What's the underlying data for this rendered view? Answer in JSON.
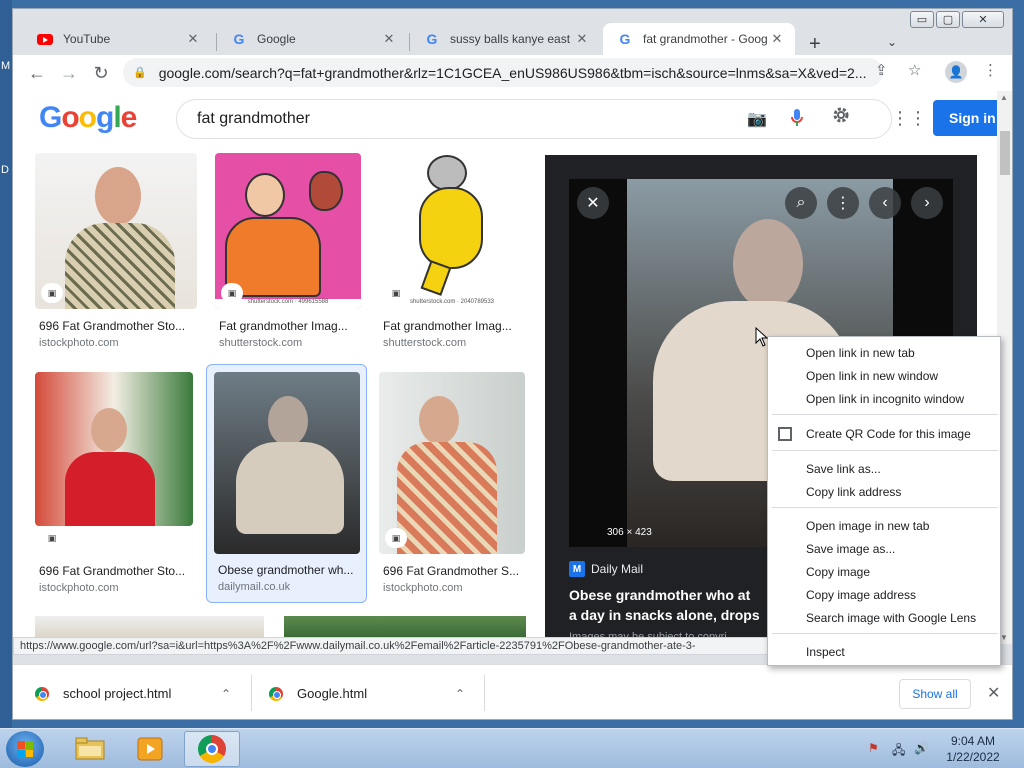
{
  "desktop": {
    "glyphs": [
      "M",
      "D"
    ]
  },
  "window_controls": {
    "minimize": "▭",
    "maximize": "▢",
    "close": "✕"
  },
  "tabs": [
    {
      "title": "YouTube",
      "icon": "youtube-icon"
    },
    {
      "title": "Google",
      "icon": "google-icon"
    },
    {
      "title": "sussy balls kanye east - G",
      "icon": "google-icon"
    },
    {
      "title": "fat grandmother - Goog",
      "icon": "google-icon",
      "active": true
    }
  ],
  "tab_close": "✕",
  "new_tab": "+",
  "tab_search": "⌄",
  "toolbar": {
    "back": "←",
    "forward": "→",
    "reload": "↻",
    "url": "google.com/search?q=fat+grandmother&rlz=1C1GCEA_enUS986US986&tbm=isch&source=lnms&sa=X&ved=2...",
    "share": "⇪",
    "bookmark": "☆",
    "profile": "●",
    "menu": "⋮"
  },
  "search": {
    "logo_letters": [
      "G",
      "o",
      "o",
      "g",
      "l",
      "e"
    ],
    "logo_colors": [
      "#4285f4",
      "#ea4335",
      "#fbbc05",
      "#4285f4",
      "#34a853",
      "#ea4335"
    ],
    "query": "fat grandmother",
    "sign_in": "Sign in"
  },
  "results": [
    {
      "caption": "696 Fat Grandmother Sto...",
      "source": "istockphoto.com"
    },
    {
      "caption": "Fat grandmother Imag...",
      "source": "shutterstock.com",
      "watermark": "shutterstock.com · 499615588"
    },
    {
      "caption": "Fat grandmother Imag...",
      "source": "shutterstock.com",
      "watermark": "shutterstock.com · 2040789533"
    },
    {
      "caption": "696 Fat Grandmother Sto...",
      "source": "istockphoto.com"
    },
    {
      "caption": "Obese grandmother wh...",
      "source": "dailymail.co.uk",
      "selected": true
    },
    {
      "caption": "696 Fat Grandmother S...",
      "source": "istockphoto.com"
    }
  ],
  "preview": {
    "close": "✕",
    "lens": "⌕",
    "more": "⋮",
    "prev": "‹",
    "next": "›",
    "dimensions": "306 × 423",
    "source": "Daily Mail",
    "source_badge": "M",
    "title_line1": "Obese grandmother who at",
    "title_line2": "a day in snacks alone, drops",
    "note": "Images may be subject to copyri"
  },
  "status_url": "https://www.google.com/url?sa=i&url=https%3A%2F%2Fwww.dailymail.co.uk%2Femail%2Farticle-2235791%2FObese-grandmother-ate-3-",
  "context_menu": {
    "groups": [
      [
        "Open link in new tab",
        "Open link in new window",
        "Open link in incognito window"
      ],
      [
        "Create QR Code for this image"
      ],
      [
        "Save link as...",
        "Copy link address"
      ],
      [
        "Open image in new tab",
        "Save image as...",
        "Copy image",
        "Copy image address",
        "Search image with Google Lens"
      ],
      [
        "Inspect"
      ]
    ]
  },
  "downloads": {
    "items": [
      "school project.html",
      "Google.html"
    ],
    "chevron": "⌃",
    "show_all": "Show all",
    "close": "✕"
  },
  "taskbar": {
    "time": "9:04 AM",
    "date": "1/22/2022",
    "apps": [
      "file-explorer-icon",
      "media-player-icon",
      "chrome-icon"
    ]
  }
}
